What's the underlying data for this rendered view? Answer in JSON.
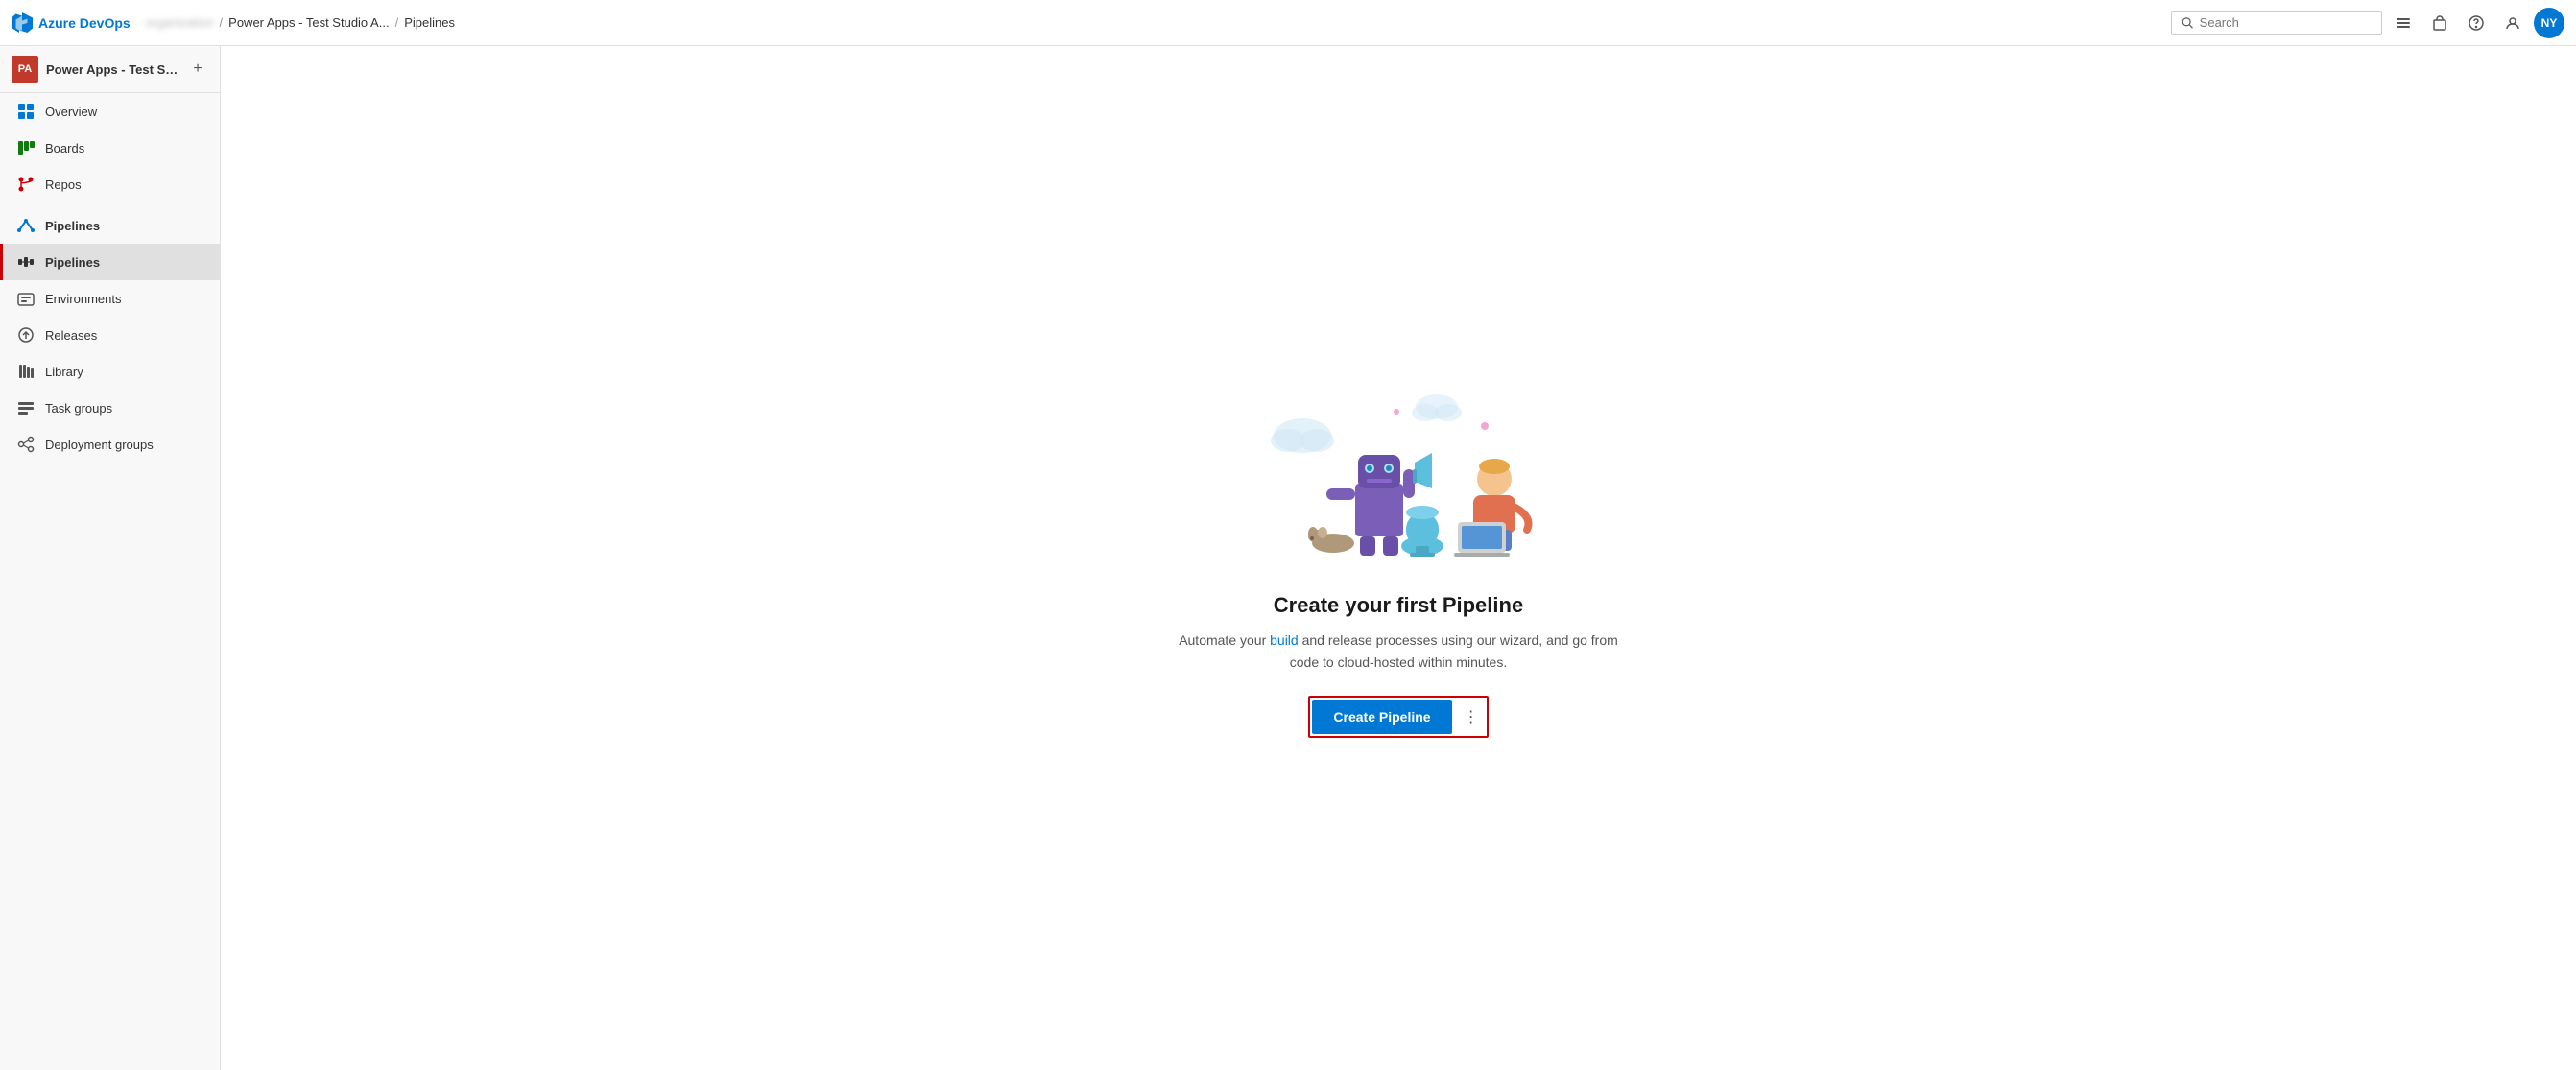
{
  "topbar": {
    "logo_text": "Azure DevOps",
    "breadcrumb": {
      "org": "organization",
      "project": "Power Apps - Test Studio A...",
      "page": "Pipelines"
    },
    "search_placeholder": "Search"
  },
  "sidebar": {
    "project_initials": "PA",
    "project_name": "Power Apps - Test Stud...",
    "add_label": "+",
    "nav_items": [
      {
        "id": "overview",
        "label": "Overview",
        "icon": "overview"
      },
      {
        "id": "boards",
        "label": "Boards",
        "icon": "boards"
      },
      {
        "id": "repos",
        "label": "Repos",
        "icon": "repos"
      },
      {
        "id": "pipelines-header",
        "label": "Pipelines",
        "icon": "pipelines-header",
        "is_header": true
      },
      {
        "id": "pipelines",
        "label": "Pipelines",
        "icon": "pipelines",
        "active": true
      },
      {
        "id": "environments",
        "label": "Environments",
        "icon": "environments"
      },
      {
        "id": "releases",
        "label": "Releases",
        "icon": "releases"
      },
      {
        "id": "library",
        "label": "Library",
        "icon": "library"
      },
      {
        "id": "task-groups",
        "label": "Task groups",
        "icon": "task-groups"
      },
      {
        "id": "deployment-groups",
        "label": "Deployment groups",
        "icon": "deployment-groups"
      }
    ]
  },
  "main": {
    "empty_state": {
      "title": "Create your first Pipeline",
      "description_part1": "Automate your build and ",
      "description_link1": "build",
      "description_part2": " and release processes using our wizard, and go from\ncode to cloud-hosted within minutes.",
      "description_full": "Automate your build and release processes using our wizard, and go from code to cloud-hosted within minutes.",
      "create_button_label": "Create Pipeline"
    }
  }
}
